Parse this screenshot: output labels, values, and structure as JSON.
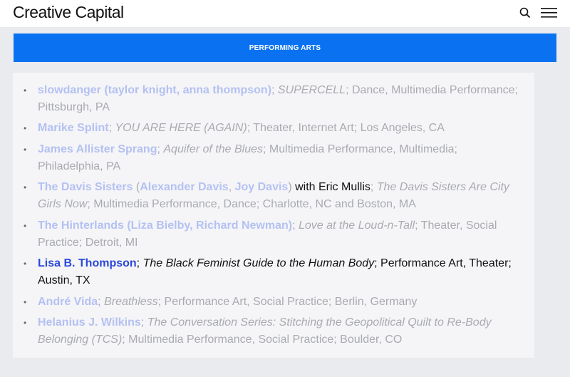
{
  "header": {
    "logo_text": "Creative Capital",
    "search_icon": "search-icon",
    "menu_icon": "hamburger-menu-icon"
  },
  "tab": {
    "label": "PERFORMING ARTS",
    "color": "#0a72f0"
  },
  "colors": {
    "link_active": "#2a49d8",
    "link_faded": "#b4c1f2",
    "text_faded": "#a9abb1"
  },
  "entries": [
    {
      "artists": "slowdanger (taylor knight, anna thompson)",
      "work": "SUPERCELL",
      "details1": "; Dance, Multimedia Performance;",
      "details2": "Pittsburgh, PA"
    },
    {
      "artists": "Marike Splint",
      "work": "YOU ARE HERE (AGAIN)",
      "details1": "; Theater, Internet Art; Los Angeles, CA"
    },
    {
      "artists": "James Allister Sprang",
      "work": "Aquifer of the Blues",
      "details1": "; Multimedia Performance, Multimedia;",
      "details2": "Philadelphia, PA"
    },
    {
      "artist_a": "The Davis Sisters",
      "artist_b": "Alexander Davis",
      "artist_c": "Joy Davis",
      "with": " with Eric Mullis",
      "work1": "The Davis Sisters Are City",
      "work2": "Girls Now",
      "details2": "; Multimedia Performance, Dance; Charlotte, NC and Boston, MA"
    },
    {
      "artists": "The Hinterlands (Liza Bielby, Richard Newman)",
      "work": "Love at the Loud-n-Tall",
      "details1": "; Theater, Social",
      "details2": "Practice; Detroit, MI"
    },
    {
      "artists": "Lisa B. Thompson",
      "work": "The Black Feminist Guide to the Human Body",
      "details1": "; Performance Art, Theater;",
      "details2": "Austin, TX"
    },
    {
      "artists": "André Vida",
      "work": "Breathless",
      "details1": "; Performance Art, Social Practice; Berlin, Germany"
    },
    {
      "artists": "Helanius J. Wilkins",
      "work1": "The Conversation Series: Stitching the Geopolitical Quilt to Re-Body",
      "work2": "Belonging (TCS)",
      "details2": "; Multimedia Performance, Social Practice; Boulder, CO"
    }
  ]
}
